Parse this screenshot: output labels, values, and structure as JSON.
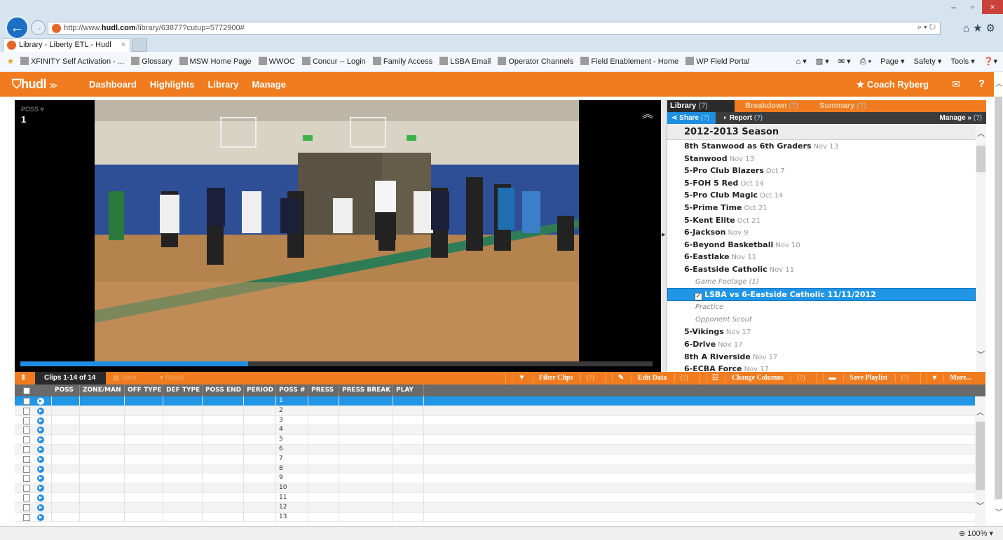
{
  "browser": {
    "url_prefix": "http://www.",
    "url_domain": "hudl.com",
    "url_path": "/library/63877?cutup=5772900#",
    "url_tools": "⌕ ▾ ↻",
    "tab_title": "Library - Liberty ETL - Hudl",
    "tab_close": "×",
    "favorites": [
      "XFINITY Self Activation - ...",
      "Glossary",
      "MSW Home Page",
      "WWOC",
      "Concur -- Login",
      "Family Access",
      "LSBA Email",
      "Operator Channels",
      "Field Enablement - Home",
      "WP Field Portal"
    ],
    "command_bar": [
      "Page ▾",
      "Safety ▾",
      "Tools ▾"
    ],
    "zoom": "100%",
    "window_controls": [
      "–",
      "▫",
      "×"
    ]
  },
  "hudl": {
    "logo": "hudl",
    "nav": [
      "Dashboard",
      "Highlights",
      "Library",
      "Manage"
    ],
    "user": "★ Coach Ryberg"
  },
  "video": {
    "poss_label": "POSS #",
    "poss_value": "1",
    "progress": 0.36
  },
  "library": {
    "tabs": [
      {
        "label": "Library",
        "help": "(?)"
      },
      {
        "label": "Breakdown",
        "help": "(?)"
      },
      {
        "label": "Summary",
        "help": "(?)"
      }
    ],
    "share": "Share",
    "report": "Report",
    "manage": "Manage »",
    "help": "(?)",
    "season": "2012-2013 Season",
    "items": [
      {
        "name": "8th Stanwood as 6th Graders",
        "date": "Nov 13"
      },
      {
        "name": "Stanwood",
        "date": "Nov 13"
      },
      {
        "name": "5-Pro Club Blazers",
        "date": "Oct 7"
      },
      {
        "name": "5-FOH 5 Red",
        "date": "Oct 14"
      },
      {
        "name": "5-Pro Club Magic",
        "date": "Oct 14"
      },
      {
        "name": "5-Prime Time",
        "date": "Oct 21"
      },
      {
        "name": "5-Kent Elite",
        "date": "Oct 21"
      },
      {
        "name": "6-Jackson",
        "date": "Nov 9"
      },
      {
        "name": "6-Beyond Basketball",
        "date": "Nov 10"
      },
      {
        "name": "6-Eastlake",
        "date": "Nov 11"
      },
      {
        "name": "6-Eastside Catholic",
        "date": "Nov 11"
      }
    ],
    "sub_game": "Game Footage (1)",
    "selected": "LSBA vs 6-Eastside Catholic 11/11/2012",
    "sub_practice": "Practice",
    "sub_scout": "Opponent Scout",
    "items_after": [
      {
        "name": "5-Vikings",
        "date": "Nov 17"
      },
      {
        "name": "6-Drive",
        "date": "Nov 17"
      },
      {
        "name": "8th A Riverside",
        "date": "Nov 17"
      },
      {
        "name": "6-ECBA Force",
        "date": "Nov 17"
      }
    ]
  },
  "clips": {
    "count": "Clips 1-14 of 14",
    "mode1": "▦ View",
    "mode2": "▾ Reset",
    "tools": [
      {
        "label": "Filter Clips",
        "icon": "▼"
      },
      {
        "label": "Edit Data",
        "icon": "✎"
      },
      {
        "label": "Change Columns",
        "icon": "☷"
      },
      {
        "label": "Save Playlist",
        "icon": "▬"
      },
      {
        "label": "More...",
        "icon": "▾"
      }
    ],
    "columns": [
      "POSS",
      "ZONE/MAN",
      "OFF TYPE",
      "DEF TYPE",
      "POSS END",
      "PERIOD",
      "POSS #",
      "PRESS",
      "PRESS BREAK",
      "PLAY"
    ],
    "rows": [
      "1",
      "2",
      "3",
      "4",
      "5",
      "6",
      "7",
      "8",
      "9",
      "10",
      "11",
      "12",
      "13"
    ],
    "selected_row": 0
  },
  "colors": {
    "accent": "#f07c1f",
    "selection": "#2196e6",
    "dark": "#2b2b2b"
  }
}
